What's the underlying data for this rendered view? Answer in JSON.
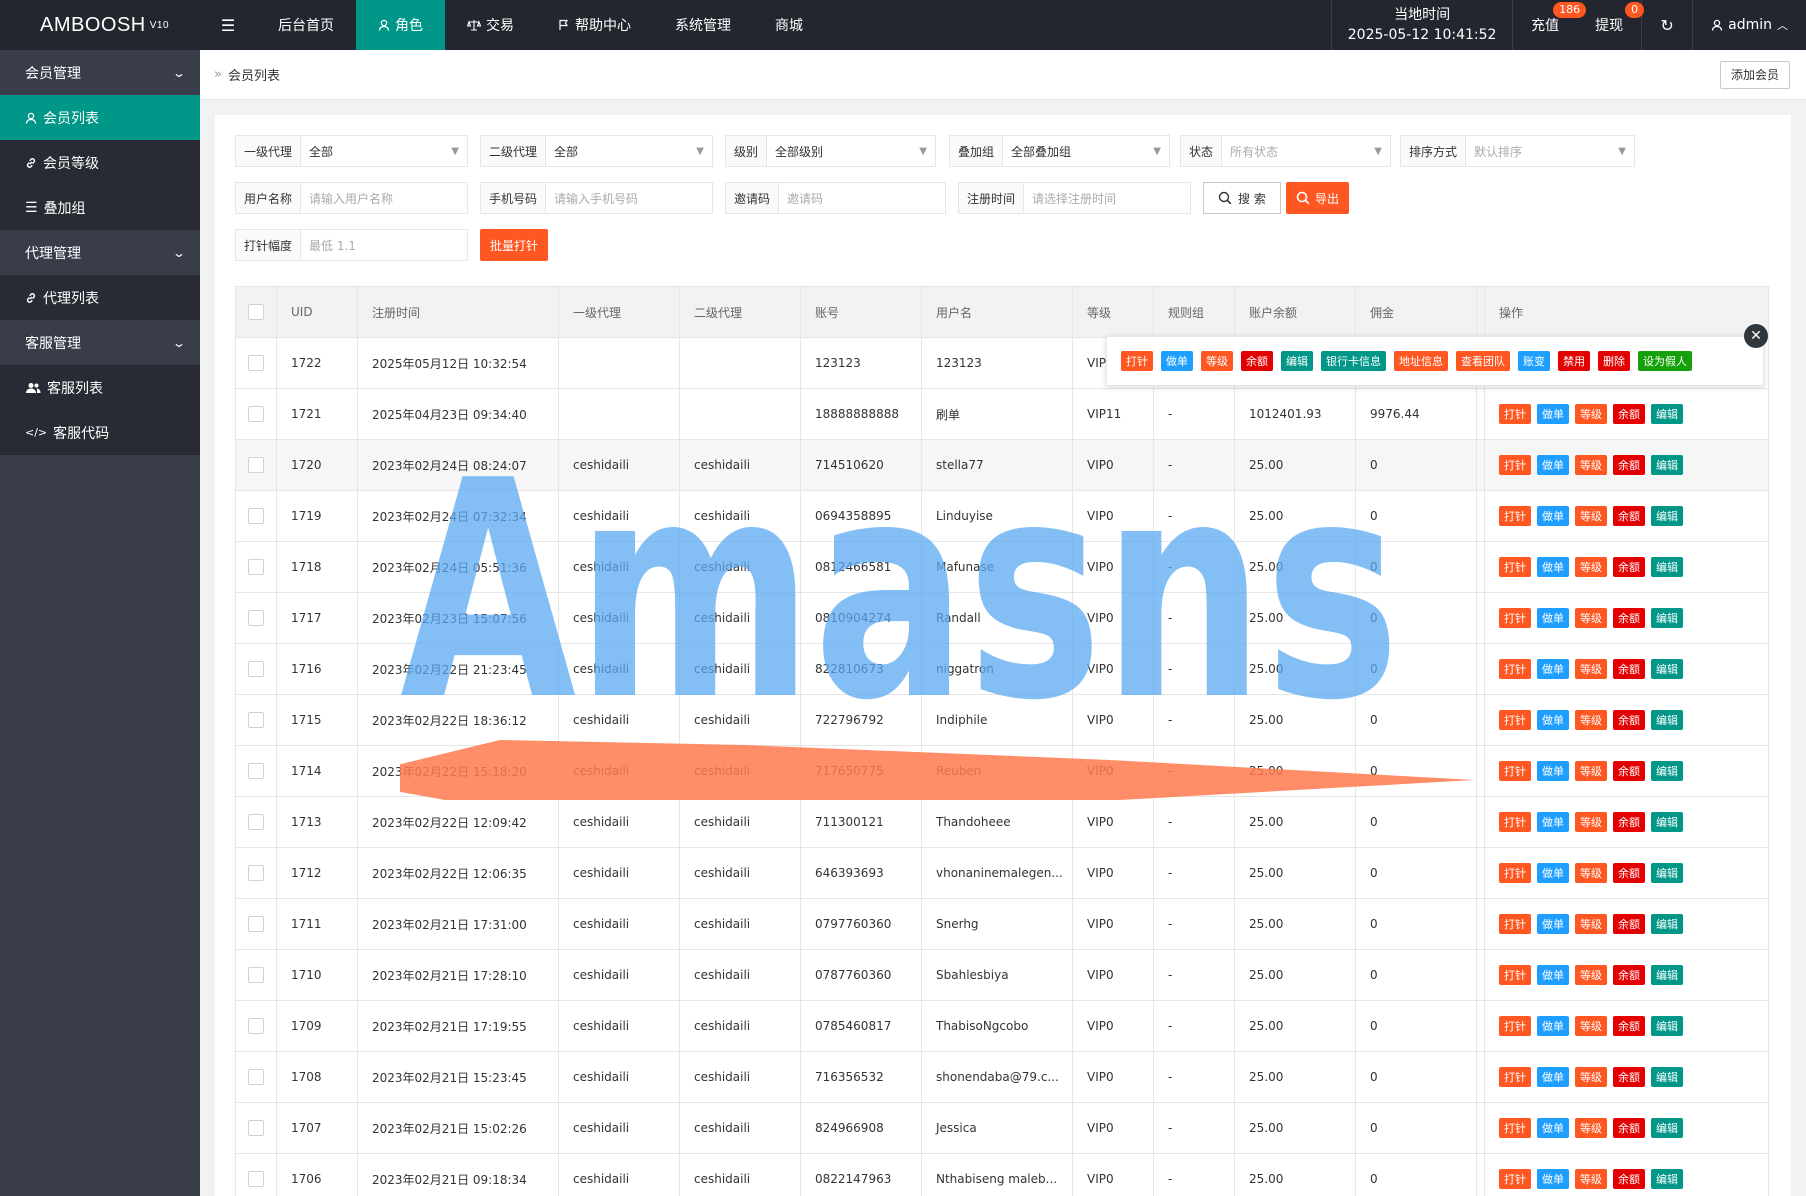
{
  "brand": {
    "name": "AMBOOSH",
    "version": "V10"
  },
  "nav": {
    "home": "后台首页",
    "role": "角色",
    "trade": "交易",
    "help": "帮助中心",
    "system": "系统管理",
    "mall": "商城"
  },
  "header": {
    "time_label": "当地时间",
    "time_value": "2025-05-12 10:41:52",
    "recharge": "充值",
    "recharge_badge": "186",
    "withdraw": "提现",
    "withdraw_badge": "0",
    "user": "admin"
  },
  "sidebar": {
    "member_mgmt": "会员管理",
    "member_list": "会员列表",
    "member_level": "会员等级",
    "stack_group": "叠加组",
    "agent_mgmt": "代理管理",
    "agent_list": "代理列表",
    "cs_mgmt": "客服管理",
    "cs_list": "客服列表",
    "cs_code": "客服代码"
  },
  "breadcrumb": {
    "title": "会员列表",
    "add_button": "添加会员"
  },
  "filters": {
    "agent1": {
      "label": "一级代理",
      "value": "全部"
    },
    "agent2": {
      "label": "二级代理",
      "value": "全部"
    },
    "level": {
      "label": "级别",
      "value": "全部级别"
    },
    "stack": {
      "label": "叠加组",
      "value": "全部叠加组"
    },
    "status": {
      "label": "状态",
      "placeholder": "所有状态"
    },
    "sort": {
      "label": "排序方式",
      "placeholder": "默认排序"
    },
    "username": {
      "label": "用户名称",
      "placeholder": "请输入用户名称"
    },
    "phone": {
      "label": "手机号码",
      "placeholder": "请输入手机号码"
    },
    "invite": {
      "label": "邀请码",
      "placeholder": "邀请码"
    },
    "regtime": {
      "label": "注册时间",
      "placeholder": "请选择注册时间"
    },
    "search_btn": "搜 索",
    "export_btn": "导出",
    "amount": {
      "label": "打针幅度",
      "placeholder": "最低 1.1"
    },
    "batch_btn": "批量打针"
  },
  "table": {
    "headers": [
      "UID",
      "注册时间",
      "一级代理",
      "二级代理",
      "账号",
      "用户名",
      "等级",
      "规则组",
      "账户余额",
      "佣金",
      "操作"
    ],
    "rows": [
      {
        "uid": "1722",
        "time": "2025年05月12日 10:32:54",
        "ag1": "",
        "ag2": "",
        "acc": "123123",
        "name": "123123",
        "lvl": "VIP",
        "rule": "",
        "bal": "",
        "com": ""
      },
      {
        "uid": "1721",
        "time": "2025年04月23日 09:34:40",
        "ag1": "",
        "ag2": "",
        "acc": "18888888888",
        "name": "刷单",
        "lvl": "VIP11",
        "rule": "-",
        "bal": "1012401.93",
        "com": "9976.44"
      },
      {
        "uid": "1720",
        "time": "2023年02月24日 08:24:07",
        "ag1": "ceshidaili",
        "ag2": "ceshidaili",
        "acc": "714510620",
        "name": "stella77",
        "lvl": "VIP0",
        "rule": "-",
        "bal": "25.00",
        "com": "0"
      },
      {
        "uid": "1719",
        "time": "2023年02月24日 07:32:34",
        "ag1": "ceshidaili",
        "ag2": "ceshidaili",
        "acc": "0694358895",
        "name": "Linduyise",
        "lvl": "VIP0",
        "rule": "-",
        "bal": "25.00",
        "com": "0"
      },
      {
        "uid": "1718",
        "time": "2023年02月24日 05:51:36",
        "ag1": "ceshidaili",
        "ag2": "ceshidaili",
        "acc": "0812466581",
        "name": "Mafunase",
        "lvl": "VIP0",
        "rule": "-",
        "bal": "25.00",
        "com": "0"
      },
      {
        "uid": "1717",
        "time": "2023年02月23日 15:07:56",
        "ag1": "ceshidaili",
        "ag2": "ceshidaili",
        "acc": "0810904274",
        "name": "Randall",
        "lvl": "VIP0",
        "rule": "-",
        "bal": "25.00",
        "com": "0"
      },
      {
        "uid": "1716",
        "time": "2023年02月22日 21:23:45",
        "ag1": "ceshidaili",
        "ag2": "ceshidaili",
        "acc": "822810673",
        "name": "niggatron",
        "lvl": "VIP0",
        "rule": "-",
        "bal": "25.00",
        "com": "0"
      },
      {
        "uid": "1715",
        "time": "2023年02月22日 18:36:12",
        "ag1": "ceshidaili",
        "ag2": "ceshidaili",
        "acc": "722796792",
        "name": "Indiphile",
        "lvl": "VIP0",
        "rule": "-",
        "bal": "25.00",
        "com": "0"
      },
      {
        "uid": "1714",
        "time": "2023年02月22日 15:18:20",
        "ag1": "ceshidaili",
        "ag2": "ceshidaili",
        "acc": "717650775",
        "name": "Reuben",
        "lvl": "VIP0",
        "rule": "-",
        "bal": "25.00",
        "com": "0"
      },
      {
        "uid": "1713",
        "time": "2023年02月22日 12:09:42",
        "ag1": "ceshidaili",
        "ag2": "ceshidaili",
        "acc": "711300121",
        "name": "Thandoheee",
        "lvl": "VIP0",
        "rule": "-",
        "bal": "25.00",
        "com": "0"
      },
      {
        "uid": "1712",
        "time": "2023年02月22日 12:06:35",
        "ag1": "ceshidaili",
        "ag2": "ceshidaili",
        "acc": "646393693",
        "name": "vhonaninemalegen...",
        "lvl": "VIP0",
        "rule": "-",
        "bal": "25.00",
        "com": "0"
      },
      {
        "uid": "1711",
        "time": "2023年02月21日 17:31:00",
        "ag1": "ceshidaili",
        "ag2": "ceshidaili",
        "acc": "0797760360",
        "name": "Snerhg",
        "lvl": "VIP0",
        "rule": "-",
        "bal": "25.00",
        "com": "0"
      },
      {
        "uid": "1710",
        "time": "2023年02月21日 17:28:10",
        "ag1": "ceshidaili",
        "ag2": "ceshidaili",
        "acc": "0787760360",
        "name": "Sbahlesbiya",
        "lvl": "VIP0",
        "rule": "-",
        "bal": "25.00",
        "com": "0"
      },
      {
        "uid": "1709",
        "time": "2023年02月21日 17:19:55",
        "ag1": "ceshidaili",
        "ag2": "ceshidaili",
        "acc": "0785460817",
        "name": "ThabisoNgcobo",
        "lvl": "VIP0",
        "rule": "-",
        "bal": "25.00",
        "com": "0"
      },
      {
        "uid": "1708",
        "time": "2023年02月21日 15:23:45",
        "ag1": "ceshidaili",
        "ag2": "ceshidaili",
        "acc": "716356532",
        "name": "shonendaba@79.c...",
        "lvl": "VIP0",
        "rule": "-",
        "bal": "25.00",
        "com": "0"
      },
      {
        "uid": "1707",
        "time": "2023年02月21日 15:02:26",
        "ag1": "ceshidaili",
        "ag2": "ceshidaili",
        "acc": "824966908",
        "name": "Jessica",
        "lvl": "VIP0",
        "rule": "-",
        "bal": "25.00",
        "com": "0"
      },
      {
        "uid": "1706",
        "time": "2023年02月21日 09:18:34",
        "ag1": "ceshidaili",
        "ag2": "ceshidaili",
        "acc": "0822147963",
        "name": "Nthabiseng maleb...",
        "lvl": "VIP0",
        "rule": "-",
        "bal": "25.00",
        "com": "0"
      }
    ],
    "row_actions": [
      {
        "label": "打针",
        "color": "orange"
      },
      {
        "label": "做单",
        "color": "blue"
      },
      {
        "label": "等级",
        "color": "orange"
      },
      {
        "label": "余额",
        "color": "red"
      },
      {
        "label": "编辑",
        "color": "teal"
      }
    ]
  },
  "popup_actions": [
    {
      "label": "打针",
      "color": "orange"
    },
    {
      "label": "做单",
      "color": "blue"
    },
    {
      "label": "等级",
      "color": "orange"
    },
    {
      "label": "余额",
      "color": "red"
    },
    {
      "label": "编辑",
      "color": "teal"
    },
    {
      "label": "银行卡信息",
      "color": "teal"
    },
    {
      "label": "地址信息",
      "color": "orange"
    },
    {
      "label": "查看团队",
      "color": "orange"
    },
    {
      "label": "账变",
      "color": "blue"
    },
    {
      "label": "禁用",
      "color": "red"
    },
    {
      "label": "删除",
      "color": "red"
    },
    {
      "label": "设为假人",
      "color": "green"
    }
  ],
  "watermark": {
    "text": "Amasns"
  },
  "colors": {
    "topbar": "#23262e",
    "sidebar": "#393d49",
    "accent": "#009688",
    "orange": "#ff5722",
    "blue": "#1e9fff",
    "red": "#e30000",
    "green": "#16a10c"
  }
}
